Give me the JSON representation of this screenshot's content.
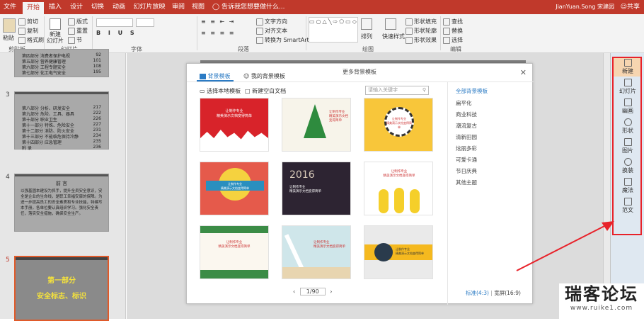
{
  "tabs": [
    "文件",
    "开始",
    "插入",
    "设计",
    "切换",
    "动画",
    "幻灯片放映",
    "审阅",
    "视图"
  ],
  "active_tab": "开始",
  "tell_me": "告诉我您想要做什么...",
  "user": "JianYuan.Song 宋建园",
  "share": "共享",
  "ribbon": {
    "paste": "粘贴",
    "cut": "剪切",
    "copy": "复制",
    "format_painter": "格式刷",
    "new_slide": "新建\n幻灯片",
    "layout": "版式",
    "reset": "重置",
    "section": "节",
    "text_direction": "文字方向",
    "align_text": "对齐文本",
    "convert_smartart": "转换为 SmartArt",
    "arrange": "排列",
    "quick_styles": "快速样式",
    "shape_fill": "形状填充",
    "shape_outline": "形状轮廓",
    "shape_effects": "形状效果",
    "find": "查找",
    "replace": "替换",
    "select": "选择",
    "groups": [
      "剪贴板",
      "幻灯片",
      "字体",
      "段落",
      "绘图",
      "编辑"
    ]
  },
  "thumbs": {
    "s2_lines": [
      {
        "t": "第四部分  消费者保护电视",
        "n": "92"
      },
      {
        "t": "第五部分  营养健康管理",
        "n": "101"
      },
      {
        "t": "第六部分  工程专题安全",
        "n": "108"
      },
      {
        "t": "第七部分  化工电气安全",
        "n": "195"
      }
    ],
    "s3_num": "3",
    "s3_lines": [
      {
        "t": "第八部分  分析、研发安全",
        "n": "217"
      },
      {
        "t": "第九部分  危险、工具、器具",
        "n": "222"
      },
      {
        "t": "第十部分  职业卫生",
        "n": "226"
      },
      {
        "t": "第十一部分  特殊、危险安全",
        "n": "227"
      },
      {
        "t": "第十二部分  消防、防火安全",
        "n": "231"
      },
      {
        "t": "第十三部分  不能临危保持冷静",
        "n": "234"
      },
      {
        "t": "第十四部分  应急管理",
        "n": "235"
      },
      {
        "t": "附    录",
        "n": "236"
      }
    ],
    "s4_num": "4",
    "s4_title": "前   言",
    "s4_text": "以强基固本建设为抓手，提升全员安全意识，安全是企业的生命线，是职工幸福安康的保障。为进一步提高员工的安全素质和专业技能，特编写本手册，各单位要认真组织学习。强化安全责任，落实安全措施，确保安全生产。",
    "s5_num": "5",
    "s5_title": "第一部分",
    "s5_subtitle": "安全标志、标识"
  },
  "dialog": {
    "title": "更多背景模板",
    "tab1": "背景模板",
    "tab2": "我的背景模板",
    "opt1": "选择本地模板",
    "opt2": "新建空白文档",
    "search_placeholder": "请输入关键字",
    "card_text": "让制作专业\n精美演示文档变得简单",
    "year": "2016",
    "categories": [
      "全部背景模板",
      "扁平化",
      "商业科技",
      "潮流复古",
      "清新田园",
      "炫丽多彩",
      "可爱卡通",
      "节日庆典",
      "其他主题"
    ],
    "page": "1/90",
    "ratio_std": "标准(4:3)",
    "ratio_sep": " | ",
    "ratio_wide": "宽屏(16:9)"
  },
  "rpanel": [
    "新建",
    "幻灯片",
    "幽画",
    "形状",
    "图片",
    "换装",
    "魔法",
    "范文"
  ],
  "watermark": {
    "main": "瑞客论坛",
    "url": "www.ruike1.com"
  },
  "colors": {
    "accent": "#c0392b",
    "panel": "#dfe8f1",
    "highlight": "#e8222a"
  }
}
